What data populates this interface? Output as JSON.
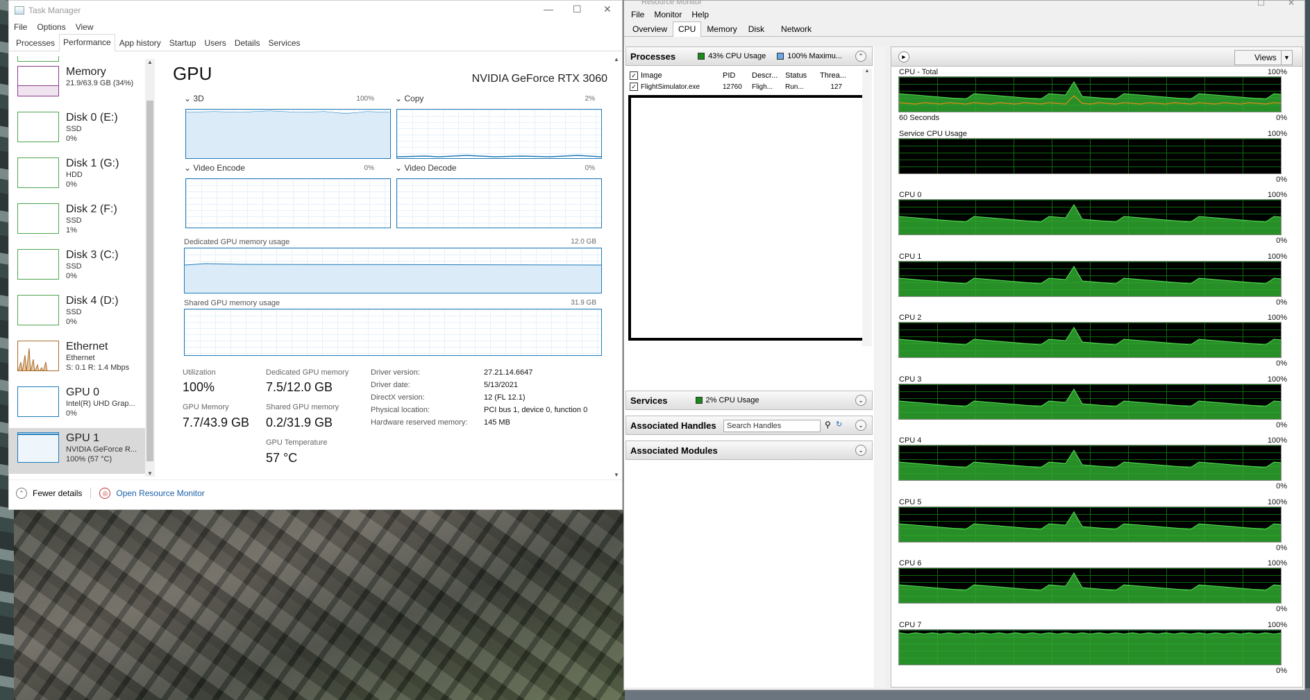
{
  "task_manager": {
    "title": "Task Manager",
    "menu": [
      "File",
      "Options",
      "View"
    ],
    "tabs": [
      "Processes",
      "Performance",
      "App history",
      "Startup",
      "Users",
      "Details",
      "Services"
    ],
    "active_tab": "Performance",
    "sidebar": [
      {
        "title": "Memory",
        "sub1": "21.9/63.9 GB (34%)",
        "sub2": "",
        "kind": "mem"
      },
      {
        "title": "Disk 0 (E:)",
        "sub1": "SSD",
        "sub2": "0%",
        "kind": "disk"
      },
      {
        "title": "Disk 1 (G:)",
        "sub1": "HDD",
        "sub2": "0%",
        "kind": "disk"
      },
      {
        "title": "Disk 2 (F:)",
        "sub1": "SSD",
        "sub2": "1%",
        "kind": "disk"
      },
      {
        "title": "Disk 3 (C:)",
        "sub1": "SSD",
        "sub2": "0%",
        "kind": "disk"
      },
      {
        "title": "Disk 4 (D:)",
        "sub1": "SSD",
        "sub2": "0%",
        "kind": "disk"
      },
      {
        "title": "Ethernet",
        "sub1": "Ethernet",
        "sub2": "S: 0.1  R: 1.4 Mbps",
        "kind": "eth"
      },
      {
        "title": "GPU 0",
        "sub1": "Intel(R) UHD Grap...",
        "sub2": "0%",
        "kind": "gpu"
      },
      {
        "title": "GPU 1",
        "sub1": "NVIDIA GeForce R...",
        "sub2": "100% (57 °C)",
        "kind": "gpusel"
      }
    ],
    "gpu": {
      "heading": "GPU",
      "name": "NVIDIA GeForce RTX 3060",
      "graphs": {
        "g3d": {
          "label": "3D",
          "max": "100%"
        },
        "copy": {
          "label": "Copy",
          "max": "2%"
        },
        "encode": {
          "label": "Video Encode",
          "max": "0%"
        },
        "decode": {
          "label": "Video Decode",
          "max": "0%"
        },
        "dedicated": {
          "label": "Dedicated GPU memory usage",
          "max": "12.0 GB"
        },
        "shared": {
          "label": "Shared GPU memory usage",
          "max": "31.9 GB"
        }
      },
      "stats": {
        "utilization_label": "Utilization",
        "utilization": "100%",
        "dedicated_label": "Dedicated GPU memory",
        "dedicated": "7.5/12.0 GB",
        "gpumem_label": "GPU Memory",
        "gpumem": "7.7/43.9 GB",
        "sharedmem_label": "Shared GPU memory",
        "sharedmem": "0.2/31.9 GB",
        "temp_label": "GPU Temperature",
        "temp": "57 °C"
      },
      "info": [
        {
          "label": "Driver version:",
          "value": "27.21.14.6647"
        },
        {
          "label": "Driver date:",
          "value": "5/13/2021"
        },
        {
          "label": "DirectX version:",
          "value": "12 (FL 12.1)"
        },
        {
          "label": "Physical location:",
          "value": "PCI bus 1, device 0, function 0"
        },
        {
          "label": "Hardware reserved memory:",
          "value": "145 MB"
        }
      ]
    },
    "footer": {
      "fewer": "Fewer details",
      "open_rm": "Open Resource Monitor"
    }
  },
  "resource_monitor": {
    "title": "Resource Monitor",
    "menu": [
      "File",
      "Monitor",
      "Help"
    ],
    "tabs": [
      "Overview",
      "CPU",
      "Memory",
      "Disk",
      "Network"
    ],
    "active_tab": "CPU",
    "processes": {
      "label": "Processes",
      "cpu_usage": "43% CPU Usage",
      "max_freq": "100% Maximu...",
      "columns": [
        "Image",
        "PID",
        "Descr...",
        "Status",
        "Threa..."
      ],
      "rows": [
        {
          "image": "FlightSimulator.exe",
          "pid": "12760",
          "desc": "Fligh...",
          "status": "Run...",
          "threads": "127"
        }
      ]
    },
    "services": {
      "label": "Services",
      "cpu_usage": "2% CPU Usage"
    },
    "handles": {
      "label": "Associated Handles",
      "placeholder": "Search Handles"
    },
    "modules": {
      "label": "Associated Modules"
    },
    "views_label": "Views",
    "cpu_graphs": [
      {
        "label": "CPU - Total",
        "max": "100%",
        "min": "0%",
        "sub": "60 Seconds"
      },
      {
        "label": "Service CPU Usage",
        "max": "100%",
        "min": "0%"
      },
      {
        "label": "CPU 0",
        "max": "100%",
        "min": "0%"
      },
      {
        "label": "CPU 1",
        "max": "100%",
        "min": "0%"
      },
      {
        "label": "CPU 2",
        "max": "100%",
        "min": "0%"
      },
      {
        "label": "CPU 3",
        "max": "100%",
        "min": "0%"
      },
      {
        "label": "CPU 4",
        "max": "100%",
        "min": "0%"
      },
      {
        "label": "CPU 5",
        "max": "100%",
        "min": "0%"
      },
      {
        "label": "CPU 6",
        "max": "100%",
        "min": "0%"
      },
      {
        "label": "CPU 7",
        "max": "100%",
        "min": "0%"
      }
    ],
    "colors": {
      "cpu_fill": "#2fa82f",
      "cpu_line": "#57e357",
      "freq_line": "#e08a1c",
      "grid": "#0e6a0e"
    }
  }
}
